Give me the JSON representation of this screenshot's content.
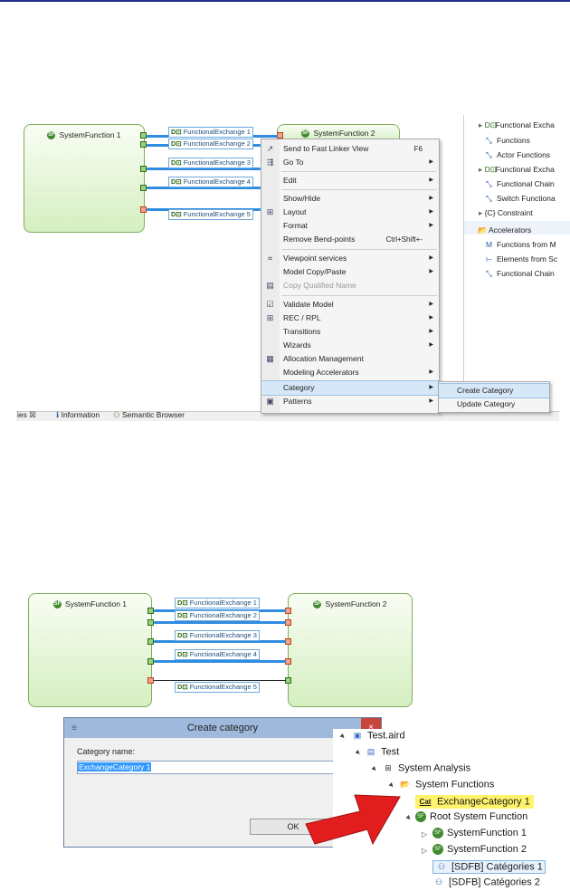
{
  "diagram_top": {
    "function1": "SystemFunction 1",
    "function2": "SystemFunction 2",
    "exchanges": [
      "FunctionalExchange 1",
      "FunctionalExchange 2",
      "FunctionalExchange 3",
      "FunctionalExchange 4",
      "FunctionalExchange 5"
    ]
  },
  "context_menu": {
    "items": [
      {
        "label": "Send to Fast Linker View",
        "shortcut": "F6",
        "icon": "send-icon"
      },
      {
        "label": "Go To",
        "arrow": true,
        "icon": "goto-icon"
      },
      {
        "label": "Edit",
        "arrow": true
      },
      {
        "label": "Show/Hide",
        "arrow": true
      },
      {
        "label": "Layout",
        "arrow": true,
        "icon": "layout-icon"
      },
      {
        "label": "Format",
        "arrow": true
      },
      {
        "label": "Remove Bend-points",
        "shortcut": "Ctrl+Shift+-"
      },
      {
        "label": "Viewpoint services",
        "arrow": true,
        "icon": "viewpoint-icon"
      },
      {
        "label": "Model Copy/Paste",
        "arrow": true
      },
      {
        "label": "Copy Qualified Name",
        "disabled": true,
        "icon": "copy-icon"
      },
      {
        "label": "Validate Model",
        "arrow": true,
        "icon": "validate-icon"
      },
      {
        "label": "REC / RPL",
        "arrow": true,
        "icon": "rec-icon"
      },
      {
        "label": "Transitions",
        "arrow": true
      },
      {
        "label": "Wizards",
        "arrow": true
      },
      {
        "label": "Allocation Management",
        "icon": "allocation-icon"
      },
      {
        "label": "Modeling Accelerators",
        "arrow": true
      },
      {
        "label": "Category",
        "arrow": true
      },
      {
        "label": "Patterns",
        "arrow": true,
        "icon": "patterns-icon"
      }
    ],
    "submenu": [
      "Create Category",
      "Update Category"
    ],
    "arrow_glyph": "▶",
    "icon_glyphs": {
      "send": "↗",
      "goto": "⇶",
      "layout": "⊞",
      "viewpoint": "∝",
      "copy": "▤",
      "validate": "☑",
      "rec": "⊞",
      "allocation": "▦",
      "patterns": "▣"
    }
  },
  "palette_panel": {
    "items": [
      {
        "label": "Functional Excha",
        "icon": "exchange-icon",
        "expand": "▸"
      },
      {
        "label": "Functions",
        "icon": "function-icon"
      },
      {
        "label": "Actor Functions",
        "icon": "function-icon"
      },
      {
        "label": "Functional Excha",
        "icon": "exchange-icon",
        "expand": "▸"
      },
      {
        "label": "Functional Chain",
        "icon": "chain-icon"
      },
      {
        "label": "Switch Functiona",
        "icon": "switch-icon"
      },
      {
        "label": "{C} Constraint",
        "expand": "▸"
      },
      {
        "label": "Accelerators",
        "icon": "folder-icon"
      },
      {
        "label": "Functions from M",
        "icon": "m-icon"
      },
      {
        "label": "Elements from Sc",
        "icon": "sc-icon"
      },
      {
        "label": "Functional Chain",
        "icon": "chain-icon"
      }
    ]
  },
  "bottom_tabs": [
    "ies ☒",
    "Information",
    "Semantic Browser"
  ],
  "diagram_bottom": {
    "function1": "SystemFunction 1",
    "function2": "SystemFunction 2",
    "exchanges": [
      "FunctionalExchange 1",
      "FunctionalExchange 2",
      "FunctionalExchange 3",
      "FunctionalExchange 4",
      "FunctionalExchange 5"
    ]
  },
  "dialog": {
    "title": "Create category",
    "label": "Category name:",
    "value": "ExchangeCategory 1",
    "ok": "OK",
    "close": "×",
    "menu_glyph": "≡"
  },
  "model_tree": {
    "nodes": [
      {
        "label": "Test.aird",
        "icon": "aird-icon"
      },
      {
        "label": "Test",
        "icon": "project-icon"
      },
      {
        "label": "System Analysis",
        "icon": "analysis-icon"
      },
      {
        "label": "System Functions",
        "icon": "folder-icon"
      },
      {
        "label": "ExchangeCategory 1",
        "icon": "category-icon",
        "glyph": "Cat"
      },
      {
        "label": "Root System Function",
        "icon": "function-icon"
      },
      {
        "label": "SystemFunction 1",
        "icon": "function-icon"
      },
      {
        "label": "SystemFunction 2",
        "icon": "function-icon"
      },
      {
        "label": "[SDFB] Catégories 1",
        "icon": "diagram-icon"
      },
      {
        "label": "[SDFB] Catégories 2",
        "icon": "diagram-icon"
      }
    ],
    "sf_glyph": "SF",
    "xi_glyph": "D⊡"
  },
  "colors": {
    "accent": "#2f8ce0",
    "highlight": "#fff36b",
    "arrow": "#e21d1d",
    "dialog_bar": "#9fb9dc"
  }
}
